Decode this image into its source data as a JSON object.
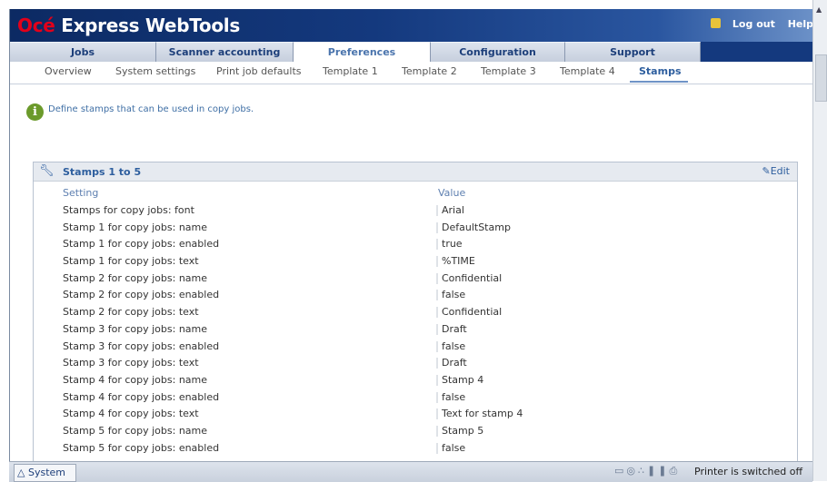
{
  "header": {
    "brand": "Océ",
    "product": "Express WebTools",
    "logout": "Log out",
    "help": "Help"
  },
  "tabs": [
    {
      "label": "Jobs"
    },
    {
      "label": "Scanner accounting"
    },
    {
      "label": "Preferences",
      "active": true
    },
    {
      "label": "Configuration"
    },
    {
      "label": "Support"
    }
  ],
  "subtabs": [
    {
      "label": "Overview"
    },
    {
      "label": "System settings"
    },
    {
      "label": "Print job defaults"
    },
    {
      "label": "Template 1"
    },
    {
      "label": "Template 2"
    },
    {
      "label": "Template 3"
    },
    {
      "label": "Template 4"
    },
    {
      "label": "Stamps",
      "active": true
    }
  ],
  "info": {
    "text": "Define stamps that can be used in copy jobs."
  },
  "panel": {
    "title": "Stamps 1 to 5",
    "edit": "Edit",
    "col_setting": "Setting",
    "col_value": "Value",
    "rows": [
      {
        "setting": "Stamps for copy jobs: font",
        "value": "Arial"
      },
      {
        "setting": "Stamp 1 for copy jobs: name",
        "value": "DefaultStamp"
      },
      {
        "setting": "Stamp 1 for copy jobs: enabled",
        "value": "true"
      },
      {
        "setting": "Stamp 1 for copy jobs: text",
        "value": "%TIME"
      },
      {
        "setting": "Stamp 2 for copy jobs: name",
        "value": "Confidential"
      },
      {
        "setting": "Stamp 2 for copy jobs: enabled",
        "value": "false"
      },
      {
        "setting": "Stamp 2 for copy jobs: text",
        "value": "Confidential"
      },
      {
        "setting": "Stamp 3 for copy jobs: name",
        "value": "Draft"
      },
      {
        "setting": "Stamp 3 for copy jobs: enabled",
        "value": "false"
      },
      {
        "setting": "Stamp 3 for copy jobs: text",
        "value": "Draft"
      },
      {
        "setting": "Stamp 4 for copy jobs: name",
        "value": "Stamp 4"
      },
      {
        "setting": "Stamp 4 for copy jobs: enabled",
        "value": "false"
      },
      {
        "setting": "Stamp 4 for copy jobs: text",
        "value": "Text for stamp 4"
      },
      {
        "setting": "Stamp 5 for copy jobs: name",
        "value": "Stamp 5"
      },
      {
        "setting": "Stamp 5 for copy jobs: enabled",
        "value": "false"
      }
    ]
  },
  "statusbar": {
    "system_tab": "System",
    "status": "Printer is switched off"
  },
  "colors": {
    "header_blue": "#14397e",
    "brand_red": "#e2001a",
    "link_blue": "#2d5e9e"
  }
}
